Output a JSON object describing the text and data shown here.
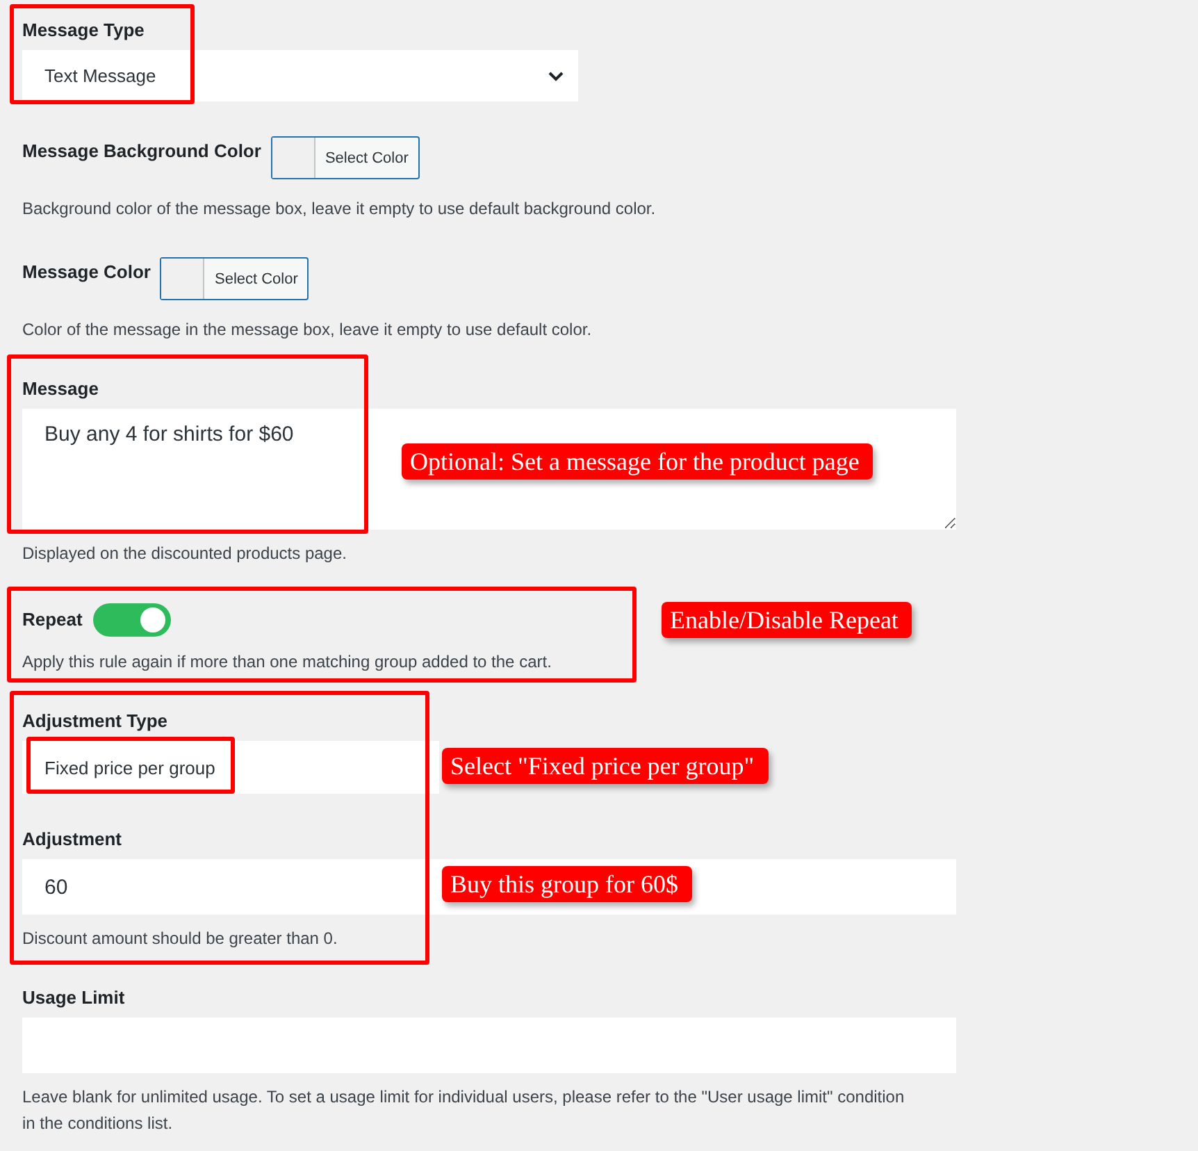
{
  "fields": [
    {
      "kind": "select",
      "label": "Message Type",
      "value": "Text Message"
    },
    {
      "kind": "color",
      "label": "Message Background Color",
      "button": "Select Color",
      "description": "Background color of the message box, leave it empty to use default background color."
    },
    {
      "kind": "color",
      "label": "Message Color",
      "button": "Select Color",
      "description": "Color of the message in the message box, leave it empty to use default color."
    },
    {
      "kind": "textarea",
      "label": "Message",
      "value": "Buy any 4 for shirts for $60",
      "description": "Displayed on the discounted products page.",
      "callout": "Optional: Set a message for the product page"
    },
    {
      "kind": "toggle",
      "label": "Repeat",
      "on": true,
      "description": "Apply this rule again if more than one matching group added to the cart.",
      "callout": "Enable/Disable Repeat"
    },
    {
      "kind": "select",
      "label": "Adjustment Type",
      "value": "Fixed price per group",
      "callout": "Select \"Fixed price per group\""
    },
    {
      "kind": "input",
      "label": "Adjustment",
      "value": "60",
      "description": "Discount amount should be greater than 0.",
      "callout": "Buy this group for 60$"
    },
    {
      "kind": "input",
      "label": "Usage Limit",
      "description": "Leave blank for unlimited usage. To set a usage limit for individual users, please refer to the \"User usage limit\" condition in the conditions list."
    }
  ]
}
